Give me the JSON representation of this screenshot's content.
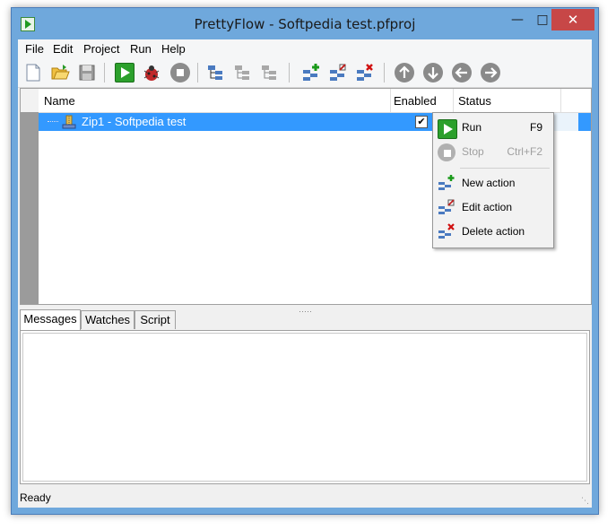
{
  "window": {
    "title": "PrettyFlow - Softpedia test.pfproj"
  },
  "menu": {
    "items": [
      "File",
      "Edit",
      "Project",
      "Run",
      "Help"
    ]
  },
  "toolbar": {
    "buttons": [
      "new-icon",
      "open-icon",
      "save-icon",
      "run-icon",
      "debug-icon",
      "stop-icon",
      "expand-icon",
      "collapse-icon",
      "indent-icon",
      "new-action-icon",
      "edit-action-icon",
      "delete-action-icon",
      "move-up-icon",
      "move-down-icon",
      "move-left-icon",
      "move-right-icon"
    ]
  },
  "tree": {
    "columns": {
      "name": "Name",
      "enabled": "Enabled",
      "status": "Status"
    },
    "rows": [
      {
        "name": "Zip1 - Softpedia test",
        "enabled": true,
        "status": ""
      }
    ]
  },
  "context_menu": {
    "items": [
      {
        "label": "Run",
        "shortcut": "F9",
        "enabled": true
      },
      {
        "label": "Stop",
        "shortcut": "Ctrl+F2",
        "enabled": false
      },
      {
        "label": "New action",
        "shortcut": "",
        "enabled": true
      },
      {
        "label": "Edit action",
        "shortcut": "",
        "enabled": true
      },
      {
        "label": "Delete action",
        "shortcut": "",
        "enabled": true
      }
    ]
  },
  "tabs": {
    "items": [
      "Messages",
      "Watches",
      "Script"
    ],
    "active": "Messages"
  },
  "statusbar": {
    "text": "Ready"
  },
  "colors": {
    "selection": "#3399ff",
    "close_button": "#c74747",
    "frame": "#6fa8dc"
  }
}
